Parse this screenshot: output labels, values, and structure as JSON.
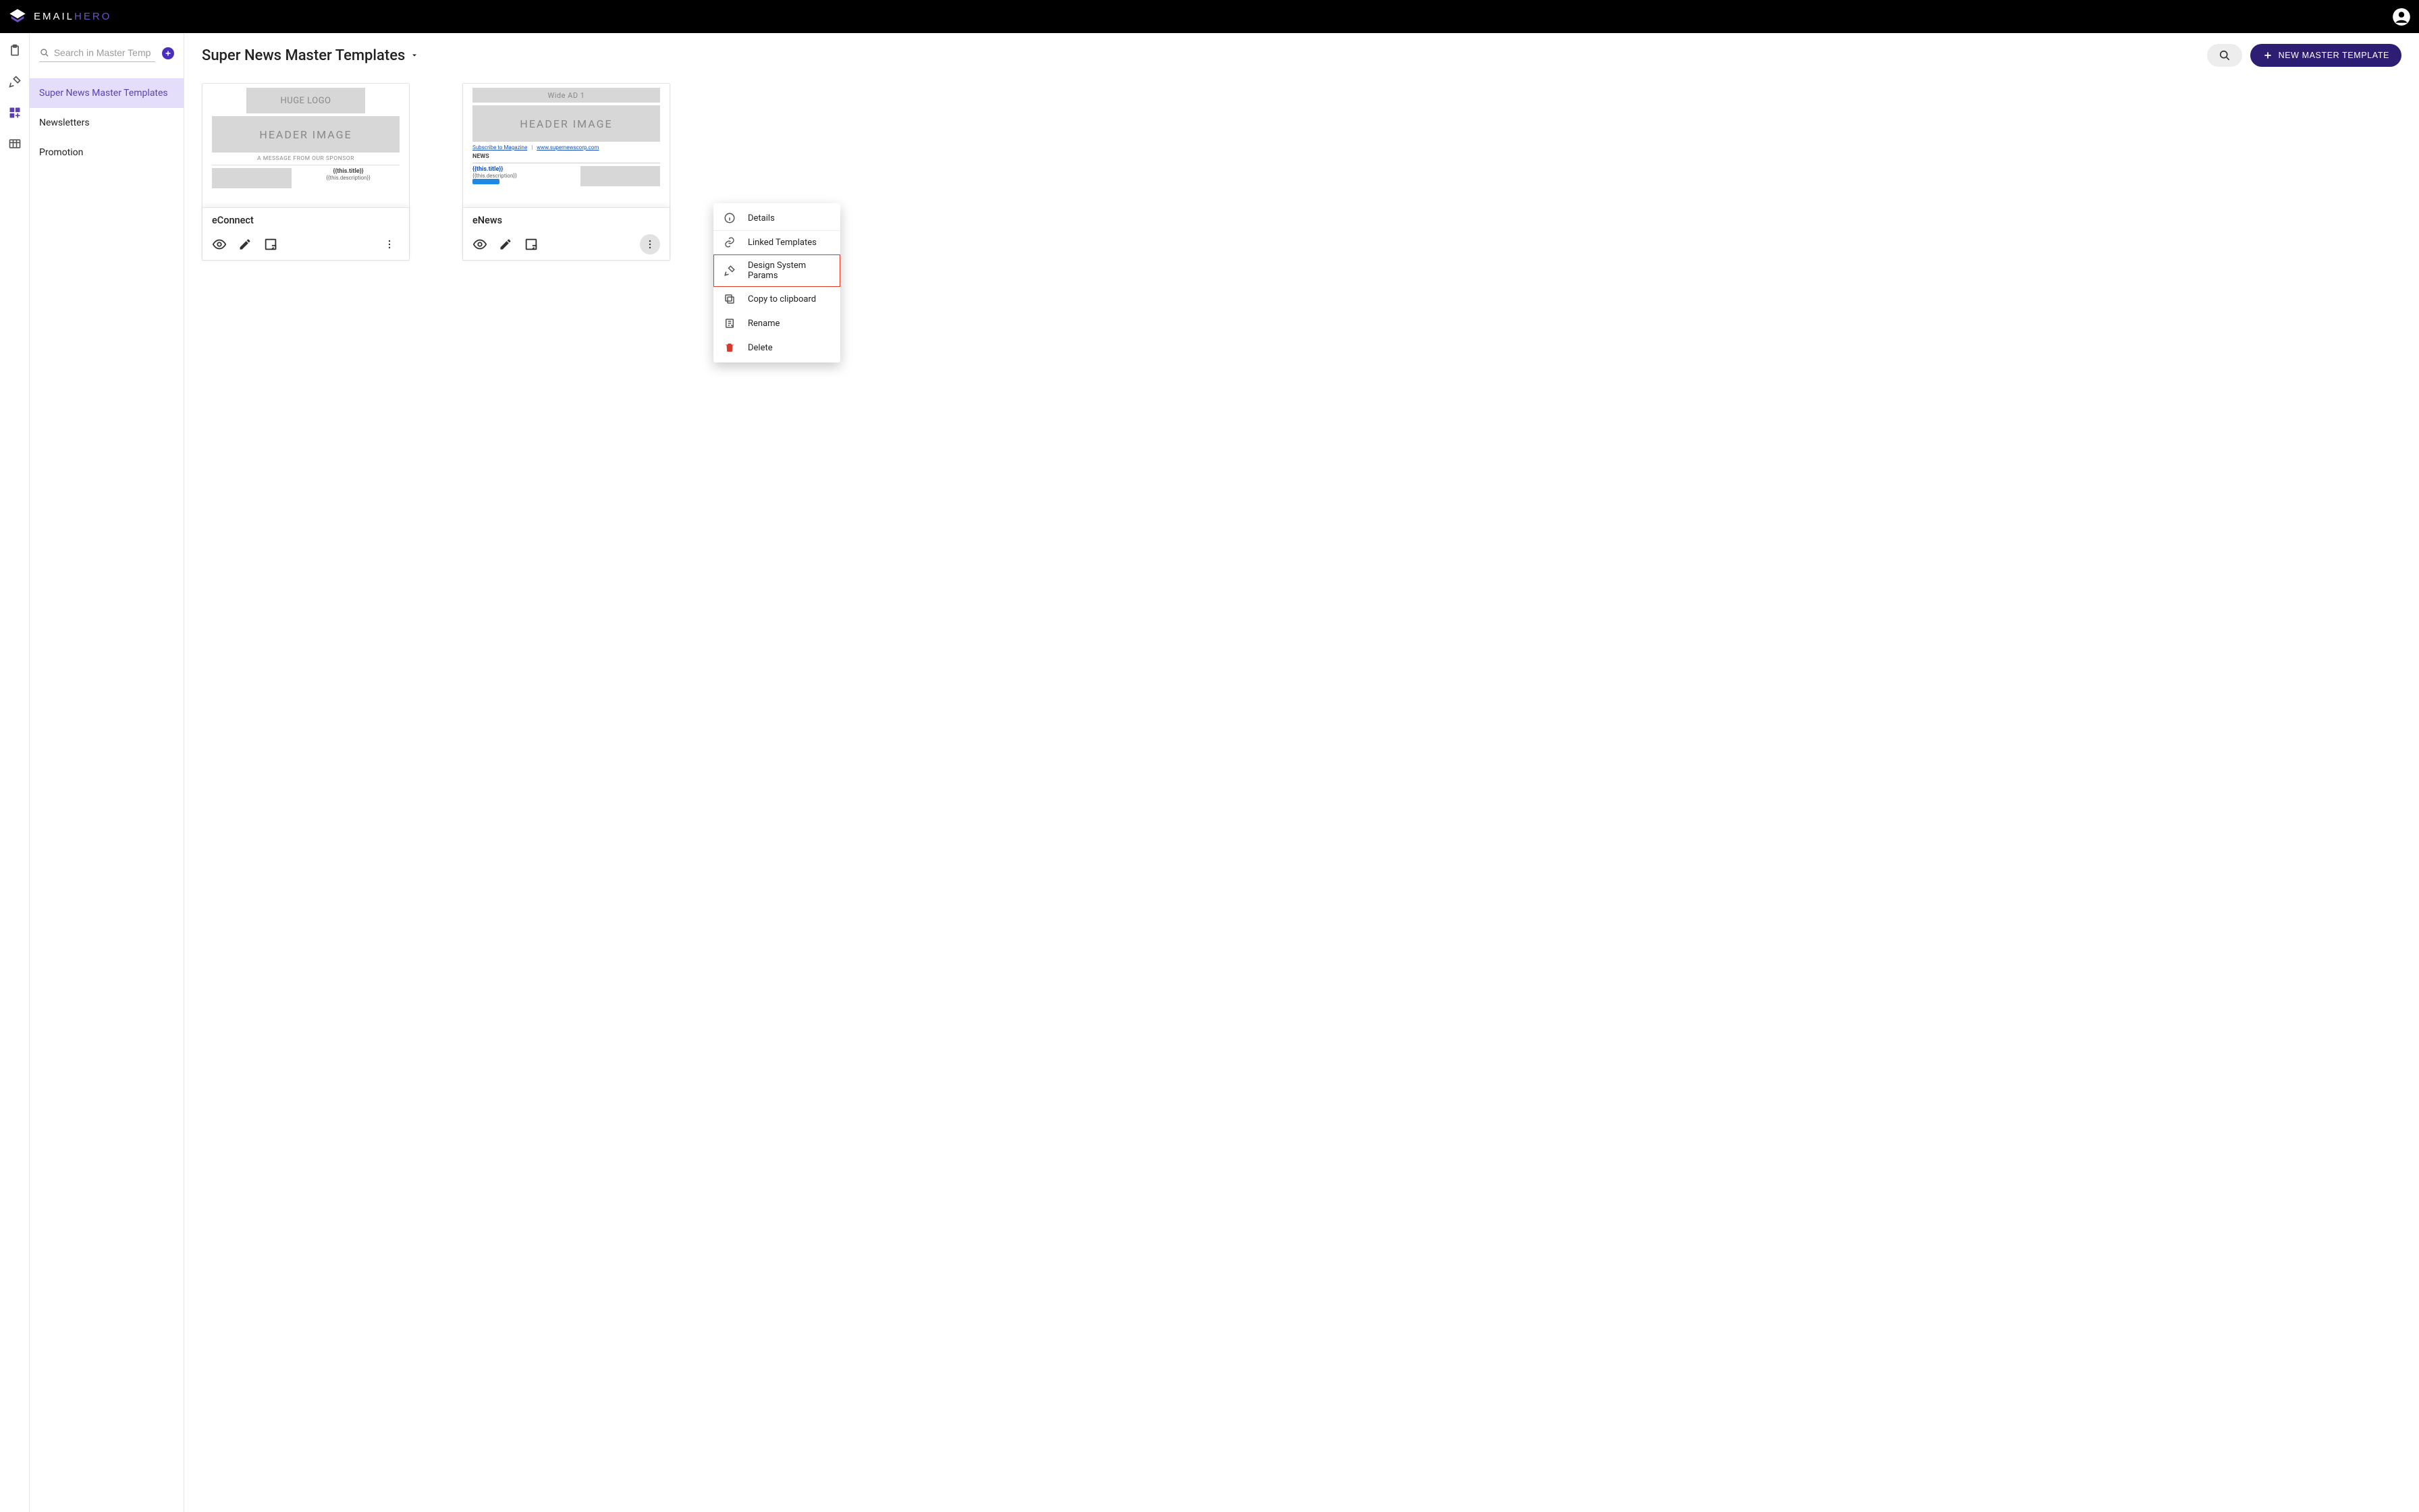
{
  "brand": {
    "prefix": "EMAIL",
    "suffix": "HERO"
  },
  "sidepanel": {
    "search_placeholder": "Search in Master Temp",
    "items": [
      {
        "label": "Super News Master Templates",
        "active": true
      },
      {
        "label": "Newsletters",
        "active": false
      },
      {
        "label": "Promotion",
        "active": false
      }
    ]
  },
  "page": {
    "title": "Super News Master Templates",
    "new_button_label": "NEW MASTER TEMPLATE"
  },
  "cards": [
    {
      "title": "eConnect",
      "thumb": {
        "logo": "HUGE LOGO",
        "header": "HEADER IMAGE",
        "sponsor": "A MESSAGE FROM OUR SPONSOR",
        "vartitle": "{{this.title}}",
        "vardesc": "{{this.description}}"
      }
    },
    {
      "title": "eNews",
      "thumb": {
        "widead": "Wide AD 1",
        "header": "HEADER IMAGE",
        "sub1": "Subscribe to Magazine",
        "sub2": "www.supernewscorp.com",
        "news": "NEWS",
        "vartitle": "{{this.title}}",
        "vardesc": "{{this.description}}"
      }
    }
  ],
  "ctx": {
    "details": "Details",
    "linked": "Linked Templates",
    "design": "Design System Params",
    "copy": "Copy to clipboard",
    "rename": "Rename",
    "delete": "Delete"
  }
}
